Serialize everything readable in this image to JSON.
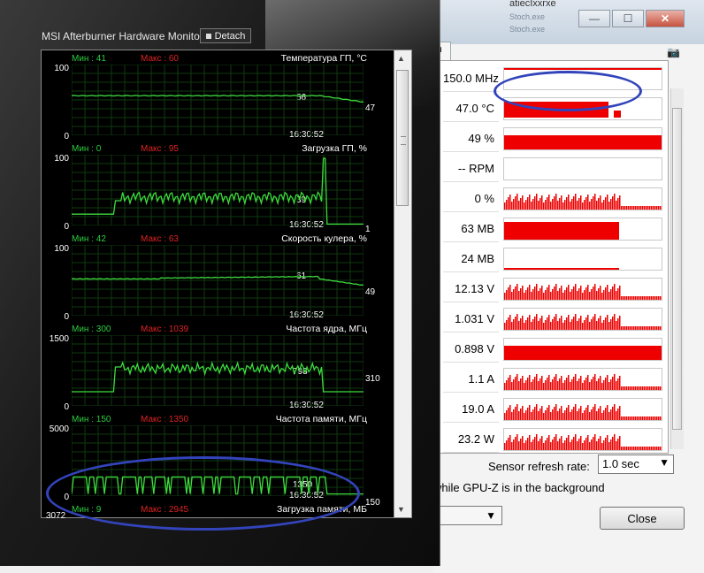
{
  "msi": {
    "title": "MSI Afterburner Hardware Monitor",
    "detach_label": "Detach",
    "time": "16:30:52",
    "below_value": "3072",
    "panels": [
      {
        "min": "Мин : 41",
        "max": "Макс : 60",
        "name": "Температура ГП, °С",
        "top": "100",
        "bottom": "0",
        "marker": "56",
        "last": "47"
      },
      {
        "min": "Мин : 0",
        "max": "Макс : 95",
        "name": "Загрузка ГП, %",
        "top": "100",
        "bottom": "0",
        "marker": "39",
        "last": "1"
      },
      {
        "min": "Мин : 42",
        "max": "Макс : 63",
        "name": "Скорость кулера, %",
        "top": "100",
        "bottom": "0",
        "marker": "61",
        "last": "49"
      },
      {
        "min": "Мин : 300",
        "max": "Макс : 1039",
        "name": "Частота ядра, МГц",
        "top": "1500",
        "bottom": "0",
        "marker": "798",
        "last": "310"
      },
      {
        "min": "Мин : 150",
        "max": "Макс : 1350",
        "name": "Частота памяти, МГц",
        "top": "5000",
        "bottom": "0",
        "marker": "1350",
        "last": "150"
      },
      {
        "min": "Мин : 9",
        "max": "Макс : 2945",
        "name": "Загрузка памяти, МБ"
      }
    ]
  },
  "gpuz": {
    "tab_fragment": "n",
    "bg_texts": [
      "atiecIxxrxe",
      "Stoch.exe",
      "Stoch.exe"
    ],
    "sensors": [
      {
        "value": "150.0 MHz"
      },
      {
        "value": "47.0 °C"
      },
      {
        "value": "49 %"
      },
      {
        "value": "-- RPM"
      },
      {
        "value": "0 %"
      },
      {
        "value": "63 MB"
      },
      {
        "value": "24 MB"
      },
      {
        "value": "12.13 V"
      },
      {
        "value": "1.031 V"
      },
      {
        "value": "0.898 V"
      },
      {
        "value": "1.1 A"
      },
      {
        "value": "19.0 A"
      },
      {
        "value": "23.2 W"
      }
    ],
    "refresh_label": "Sensor refresh rate:",
    "refresh_value": "1.0 sec",
    "background_text": "while GPU-Z is in the background",
    "close_label": "Close"
  },
  "colors": {
    "graph_green": "#3ddc3d",
    "sensor_red": "#ee0000",
    "annotation_blue": "#3344bb"
  },
  "icons": [
    "minimize-icon",
    "maximize-icon",
    "close-icon",
    "camera-icon",
    "chevron-down-icon",
    "scroll-up-icon",
    "scroll-down-icon"
  ]
}
